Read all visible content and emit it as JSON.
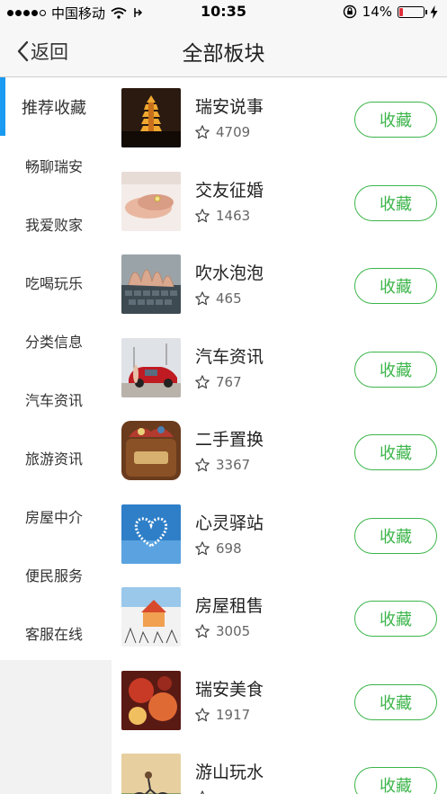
{
  "status_bar": {
    "carrier": "中国移动",
    "time": "10:35",
    "battery_percent": "14%",
    "battery_level": 0.14,
    "signal_bars": 4
  },
  "nav": {
    "back_label": "返回",
    "title": "全部板块"
  },
  "sidebar": {
    "items": [
      {
        "label": "推荐收藏",
        "active": true
      },
      {
        "label": "畅聊瑞安",
        "active": false
      },
      {
        "label": "我爱败家",
        "active": false
      },
      {
        "label": "吃喝玩乐",
        "active": false
      },
      {
        "label": "分类信息",
        "active": false
      },
      {
        "label": "汽车资讯",
        "active": false
      },
      {
        "label": "旅游资讯",
        "active": false
      },
      {
        "label": "房屋中介",
        "active": false
      },
      {
        "label": "便民服务",
        "active": false
      },
      {
        "label": "客服在线",
        "active": false
      }
    ]
  },
  "boards": {
    "button_label": "收藏",
    "items": [
      {
        "name": "瑞安说事",
        "count": "4709",
        "icon": "pagoda-night-photo"
      },
      {
        "name": "交友征婚",
        "count": "1463",
        "icon": "holding-hands-photo"
      },
      {
        "name": "吹水泡泡",
        "count": "465",
        "icon": "typing-keyboard-photo"
      },
      {
        "name": "汽车资讯",
        "count": "767",
        "icon": "red-car-photo"
      },
      {
        "name": "二手置换",
        "count": "3367",
        "icon": "treasure-box-photo"
      },
      {
        "name": "心灵驿站",
        "count": "698",
        "icon": "heart-sky-photo"
      },
      {
        "name": "房屋租售",
        "count": "3005",
        "icon": "house-sketch-photo"
      },
      {
        "name": "瑞安美食",
        "count": "1917",
        "icon": "food-photo"
      },
      {
        "name": "游山玩水",
        "count": "",
        "icon": "cyclist-photo"
      }
    ]
  },
  "colors": {
    "accent_green": "#3cb54a",
    "active_blue": "#1a9af0",
    "battery_red": "#e0303a"
  }
}
